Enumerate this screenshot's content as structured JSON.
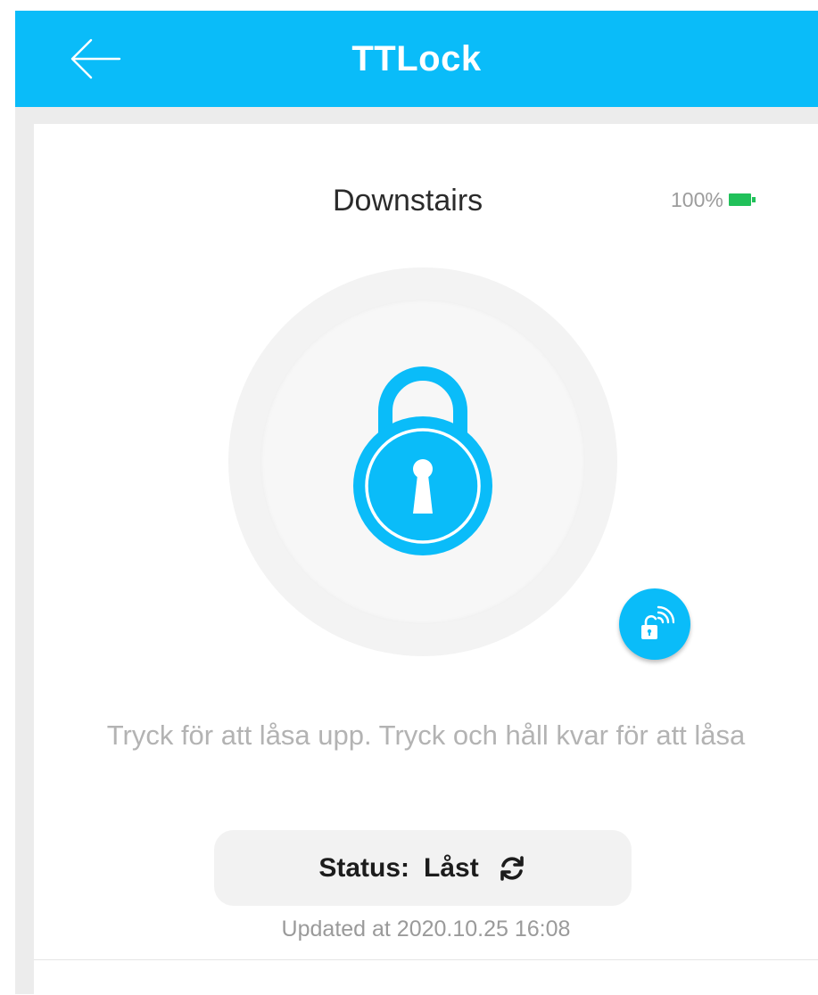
{
  "header": {
    "title": "TTLock",
    "back_icon": "arrow-left-icon",
    "background_color": "#0abcf9"
  },
  "lock": {
    "name": "Downstairs",
    "battery_percent": "100%",
    "battery_level": 1.0,
    "battery_color": "#21c15a",
    "icon": "padlock-icon",
    "ekey_icon": "wireless-unlock-icon"
  },
  "hint_text": "Tryck för att låsa upp. Tryck och håll kvar för att låsa",
  "status": {
    "label": "Status:",
    "value": "Låst",
    "refresh_icon": "refresh-icon",
    "updated_at": "Updated at 2020.10.25 16:08"
  }
}
